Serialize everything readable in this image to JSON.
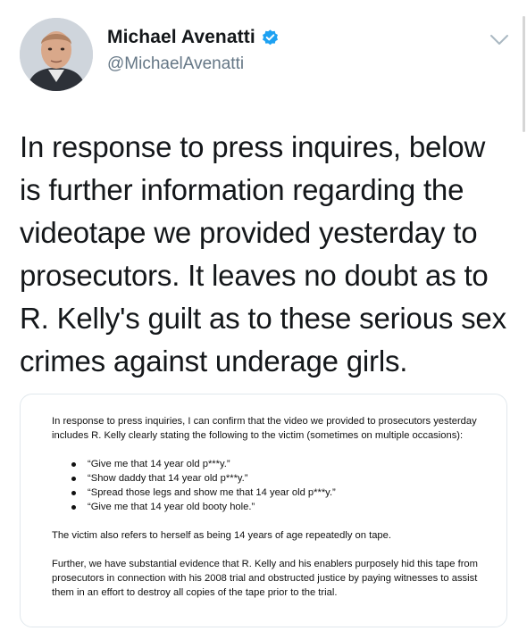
{
  "tweet": {
    "author": {
      "display_name": "Michael Avenatti",
      "handle": "@MichaelAvenatti",
      "verified": true
    },
    "text": "In response to press inquires, below is further information regarding the videotape we provided yesterday to prosecutors. It leaves no doubt as to R. Kelly's guilt as to these serious sex crimes against underage girls.",
    "attachment": {
      "intro": "In response to press inquiries, I can confirm that the video we provided to prosecutors yesterday includes R. Kelly clearly stating the following to the victim (sometimes on multiple occasions):",
      "bullets": [
        "“Give me that 14 year old p***y.”",
        "“Show daddy that 14 year old p***y.”",
        "“Spread those legs and show me that 14 year old p***y.”",
        "“Give me that 14 year old booty hole.”"
      ],
      "paragraph_2": "The victim also refers to herself as being 14 years of age repeatedly on tape.",
      "paragraph_3": "Further, we have substantial evidence that R. Kelly and his enablers purposely hid this tape from prosecutors in connection with his 2008 trial and obstructed justice by paying witnesses to assist them in an effort to destroy all copies of the tape prior to the trial."
    }
  },
  "icons": {
    "verified": "verified-badge-icon",
    "more": "chevron-down-icon"
  },
  "colors": {
    "text_primary": "#14171a",
    "text_secondary": "#657786",
    "verified_blue": "#1da1f2",
    "card_border": "#e1e8ed"
  }
}
